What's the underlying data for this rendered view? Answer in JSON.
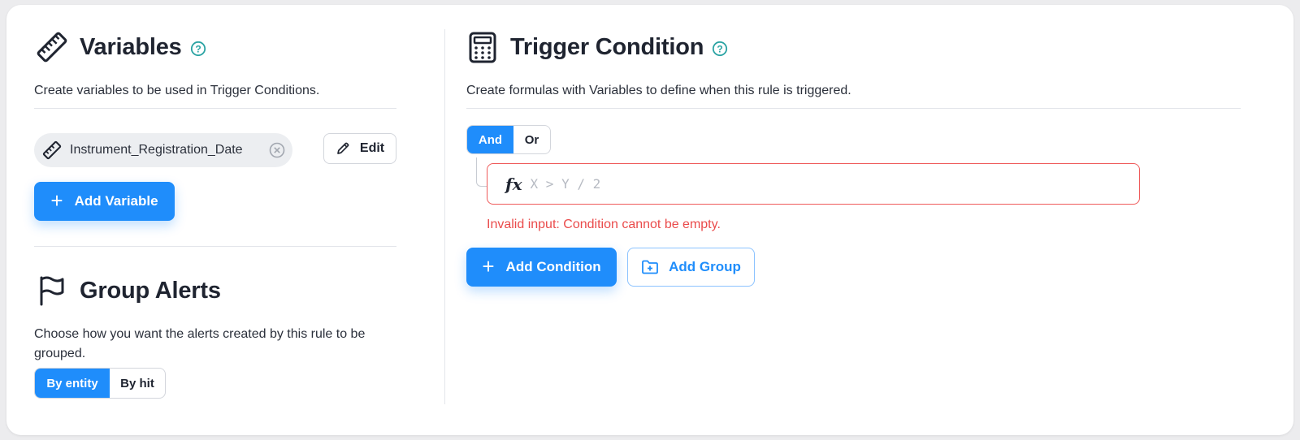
{
  "variables": {
    "title": "Variables",
    "description": "Create variables to be used in Trigger Conditions.",
    "chips": [
      {
        "label": "Instrument_Registration_Date"
      }
    ],
    "edit_label": "Edit",
    "add_label": "Add Variable"
  },
  "group_alerts": {
    "title": "Group Alerts",
    "description": "Choose how you want the alerts created by this rule to be grouped.",
    "options": [
      "By entity",
      "By hit"
    ],
    "selected": "By entity"
  },
  "trigger": {
    "title": "Trigger Condition",
    "description": "Create formulas with Variables to define when this rule is triggered.",
    "operators": [
      "And",
      "Or"
    ],
    "selected_operator": "And",
    "formula_icon": "fx",
    "formula_placeholder": "X > Y / 2",
    "formula_value": "",
    "error": "Invalid input: Condition cannot be empty.",
    "add_condition_label": "Add Condition",
    "add_group_label": "Add Group"
  },
  "colors": {
    "primary": "#1f8dfb",
    "error": "#ea4b4b",
    "help": "#2aa3a3"
  },
  "icons": [
    "ruler-icon",
    "help-icon",
    "close-circle-icon",
    "pencil-icon",
    "plus-icon",
    "flag-icon",
    "calculator-icon",
    "folder-plus-icon",
    "fx-icon"
  ]
}
